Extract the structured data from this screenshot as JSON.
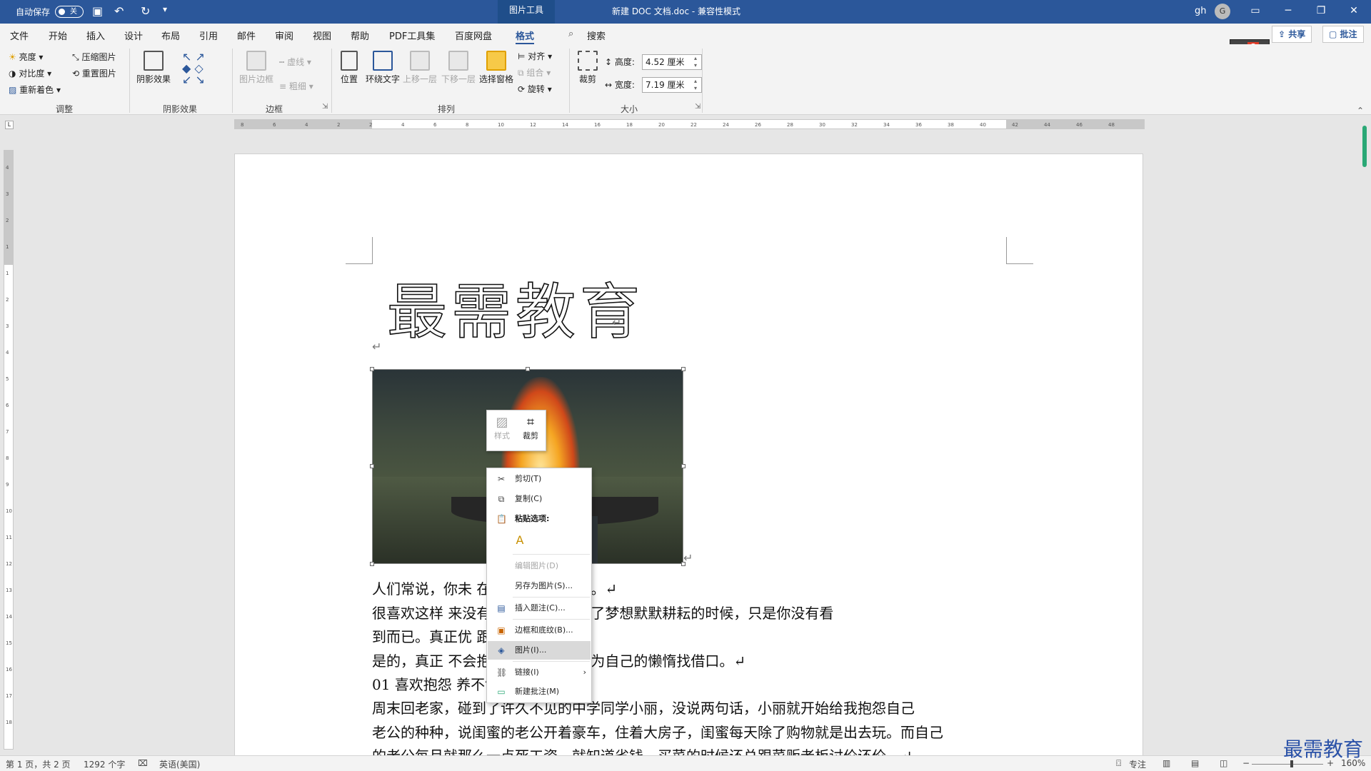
{
  "titlebar": {
    "autosave_label": "自动保存",
    "autosave_state": "关",
    "context_tab": "图片工具",
    "document_title": "新建 DOC 文档.doc  -  兼容性模式",
    "user_name": "gh",
    "avatar_initial": "G"
  },
  "tabs": [
    "文件",
    "开始",
    "插入",
    "设计",
    "布局",
    "引用",
    "邮件",
    "审阅",
    "视图",
    "帮助",
    "PDF工具集",
    "百度网盘",
    "格式"
  ],
  "search_label": "搜索",
  "share_label": "共享",
  "comment_label": "批注",
  "ribbon": {
    "adjust": {
      "brightness": "亮度",
      "contrast": "对比度",
      "recolor": "重新着色",
      "compress": "压缩图片",
      "reset": "重置图片",
      "group": "调整"
    },
    "shadow": {
      "effects": "阴影效果",
      "group": "阴影效果"
    },
    "border": {
      "picture_border": "图片边框",
      "dashes": "虚线",
      "weight": "粗细",
      "group": "边框"
    },
    "arrange": {
      "position": "位置",
      "wrap": "环绕文字",
      "forward": "上移一层",
      "backward": "下移一层",
      "selection": "选择窗格",
      "align": "对齐",
      "group_obj": "组合",
      "rotate": "旋转",
      "group": "排列"
    },
    "size": {
      "crop": "裁剪",
      "height_label": "高度:",
      "height_value": "4.52 厘米",
      "width_label": "宽度:",
      "width_value": "7.19 厘米",
      "group": "大小"
    }
  },
  "ruler": {
    "h_ticks": [
      "8",
      "6",
      "4",
      "2",
      "2",
      "4",
      "6",
      "8",
      "10",
      "12",
      "14",
      "16",
      "18",
      "20",
      "22",
      "24",
      "26",
      "28",
      "30",
      "32",
      "34",
      "36",
      "38",
      "40",
      "42",
      "44",
      "46",
      "48"
    ],
    "v_ticks": [
      "4",
      "3",
      "2",
      "1",
      "1",
      "2",
      "3",
      "4",
      "5",
      "6",
      "7",
      "8",
      "9",
      "10",
      "11",
      "12",
      "13",
      "14",
      "15",
      "16",
      "17",
      "18"
    ]
  },
  "document": {
    "headline": "最需教育",
    "return_mark": "↵",
    "lines": [
      "人们常说，你未                              在你现在的努力里。↵",
      "      很喜欢这样                              来没有捷径，当别人为了梦想默默耕耘的时候，只是你没有看",
      "到而已。真正优                              跟生活抬杠。↵",
      "      是的，真正                              不会抱怨生活，也不会为自己的懒惰找借口。↵",
      "      01  喜欢抱怨                              养不够↵",
      "      周末回老家，碰到了许久不见的中学同学小丽，没说两句话，小丽就开始给我抱怨自己",
      "老公的种种，说闺蜜的老公开着豪车，住着大房子，闺蜜每天除了购物就是出去玩。而自己",
      "的老公每月就那么一点死工资，就知道省钱，买菜的时候还总跟菜贩老板讨价还价。↵"
    ]
  },
  "mini_toolbar": {
    "style": "样式",
    "crop": "裁剪"
  },
  "context_menu": {
    "cut": "剪切(T)",
    "copy": "复制(C)",
    "paste_options": "粘贴选项:",
    "edit_picture": "编辑图片(D)",
    "save_as": "另存为图片(S)...",
    "insert_caption": "插入题注(C)...",
    "borders": "边框和底纹(B)...",
    "picture": "图片(I)...",
    "link": "链接(I)",
    "new_comment": "新建批注(M)"
  },
  "statusbar": {
    "page": "第 1 页，共 2 页",
    "words": "1292 个字",
    "language": "英语(美国)",
    "focus": "专注",
    "zoom": "160%"
  },
  "watermark": "最需教育"
}
